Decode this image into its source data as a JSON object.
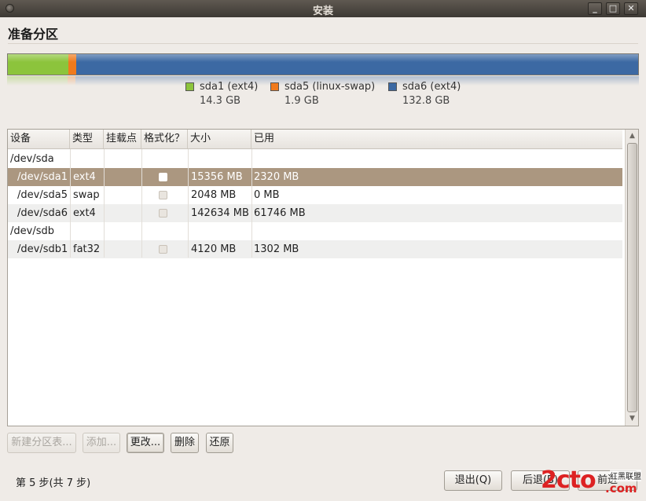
{
  "window": {
    "title": "安装",
    "minimize_label": "_",
    "maximize_label": "□",
    "close_label": "✕"
  },
  "page": {
    "heading": "准备分区"
  },
  "partition_bar": {
    "segments": [
      {
        "name": "sda1 (ext4)",
        "size": "14.3 GB",
        "gb": 14.3,
        "color": "#8cc43c"
      },
      {
        "name": "sda5 (linux-swap)",
        "size": "1.9 GB",
        "gb": 1.9,
        "color": "#f07a1c"
      },
      {
        "name": "sda6 (ext4)",
        "size": "132.8 GB",
        "gb": 132.8,
        "color": "#3c69a3"
      }
    ]
  },
  "table": {
    "columns": [
      "设备",
      "类型",
      "挂载点",
      "格式化？",
      "大小",
      "已用"
    ],
    "rows": [
      {
        "device": "/dev/sda",
        "type": "",
        "mount": "",
        "format": null,
        "size": "",
        "used": "",
        "indent": false
      },
      {
        "device": "/dev/sda1",
        "type": "ext4",
        "mount": "",
        "format": false,
        "size": "15356 MB",
        "used": "2320 MB",
        "indent": true,
        "selected": true
      },
      {
        "device": "/dev/sda5",
        "type": "swap",
        "mount": "",
        "format": false,
        "size": "2048 MB",
        "used": "0 MB",
        "indent": true
      },
      {
        "device": "/dev/sda6",
        "type": "ext4",
        "mount": "",
        "format": false,
        "size": "142634 MB",
        "used": "61746 MB",
        "indent": true
      },
      {
        "device": "/dev/sdb",
        "type": "",
        "mount": "",
        "format": null,
        "size": "",
        "used": "",
        "indent": false
      },
      {
        "device": "/dev/sdb1",
        "type": "fat32",
        "mount": "",
        "format": false,
        "size": "4120 MB",
        "used": "1302 MB",
        "indent": true
      }
    ]
  },
  "actions": {
    "new_table": "新建分区表...",
    "add": "添加...",
    "change": "更改...",
    "delete": "删除",
    "revert": "还原"
  },
  "footer": {
    "step": "第 5 步(共 7 步)",
    "quit": "退出(Q)",
    "back": "后退(B)",
    "forward": "前进"
  },
  "watermark": {
    "brand": "2cto",
    "sub": "红黑联盟",
    "tld": ".com"
  },
  "scrollbar": {
    "up_icon": "▲",
    "down_icon": "▼"
  }
}
